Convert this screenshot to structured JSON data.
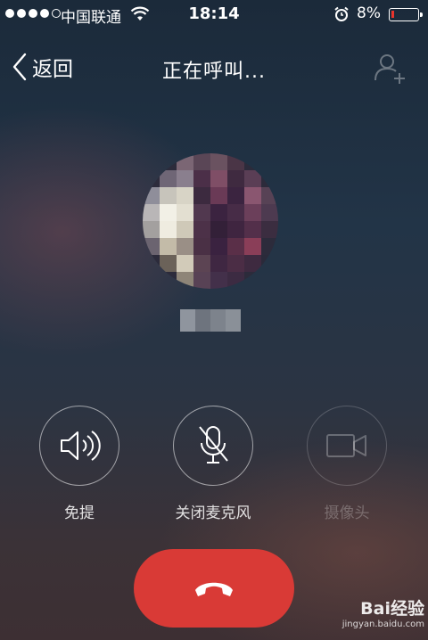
{
  "status_bar": {
    "carrier": "中国联通",
    "time": "18:14",
    "battery_percent": "8%",
    "battery_level": 0.08,
    "signal_bars_filled": 4,
    "signal_bars_total": 5
  },
  "nav": {
    "back_label": "返回",
    "title": "正在呼叫...",
    "right_icon": "add-contact-icon"
  },
  "controls": {
    "speaker_label": "免提",
    "mute_label": "关闭麦克风",
    "camera_label": "摄像头"
  },
  "watermark": {
    "logo": "Bai经验",
    "url": "jingyan.baidu.com"
  },
  "colors": {
    "hangup": "#d93a36",
    "battery_low": "#e8342c"
  }
}
